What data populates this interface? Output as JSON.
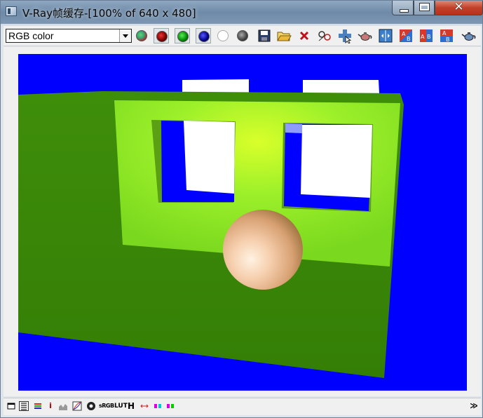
{
  "window": {
    "title": "V-Ray帧缓存-[100% of 640 x 480]",
    "close_glyph": "✕"
  },
  "toolbar": {
    "channel_value": "RGB color",
    "buttons": [
      {
        "name": "rgb-channel-icon",
        "color": "#808080"
      },
      {
        "name": "red-channel-icon",
        "color": "#800000"
      },
      {
        "name": "green-channel-icon",
        "color": "#00a000"
      },
      {
        "name": "blue-channel-icon",
        "color": "#000080"
      },
      {
        "name": "alpha-channel-icon",
        "color": "#ffffff"
      },
      {
        "name": "mono-channel-icon",
        "color": "#606060"
      },
      {
        "name": "save-icon"
      },
      {
        "name": "open-folder-icon"
      },
      {
        "name": "clear-icon"
      },
      {
        "name": "track-mouse-icon"
      },
      {
        "name": "region-render-icon"
      },
      {
        "name": "render-teapot-icon"
      },
      {
        "name": "compare-ab-icon"
      },
      {
        "name": "history-a-icon"
      },
      {
        "name": "history-b-icon"
      },
      {
        "name": "swap-ab-icon"
      },
      {
        "name": "last-render-teapot-icon"
      }
    ]
  },
  "scene": {
    "background_color": "#0000ff",
    "wall_color": "#3c8a08",
    "panel_color": "#aaff22",
    "sphere_color": "#f1c4a0"
  },
  "bottombar": {
    "info_label": "i",
    "srgb_label": "sRGB",
    "lut_label": "LUT",
    "h_label": "H",
    "expand_glyph": "≫"
  }
}
